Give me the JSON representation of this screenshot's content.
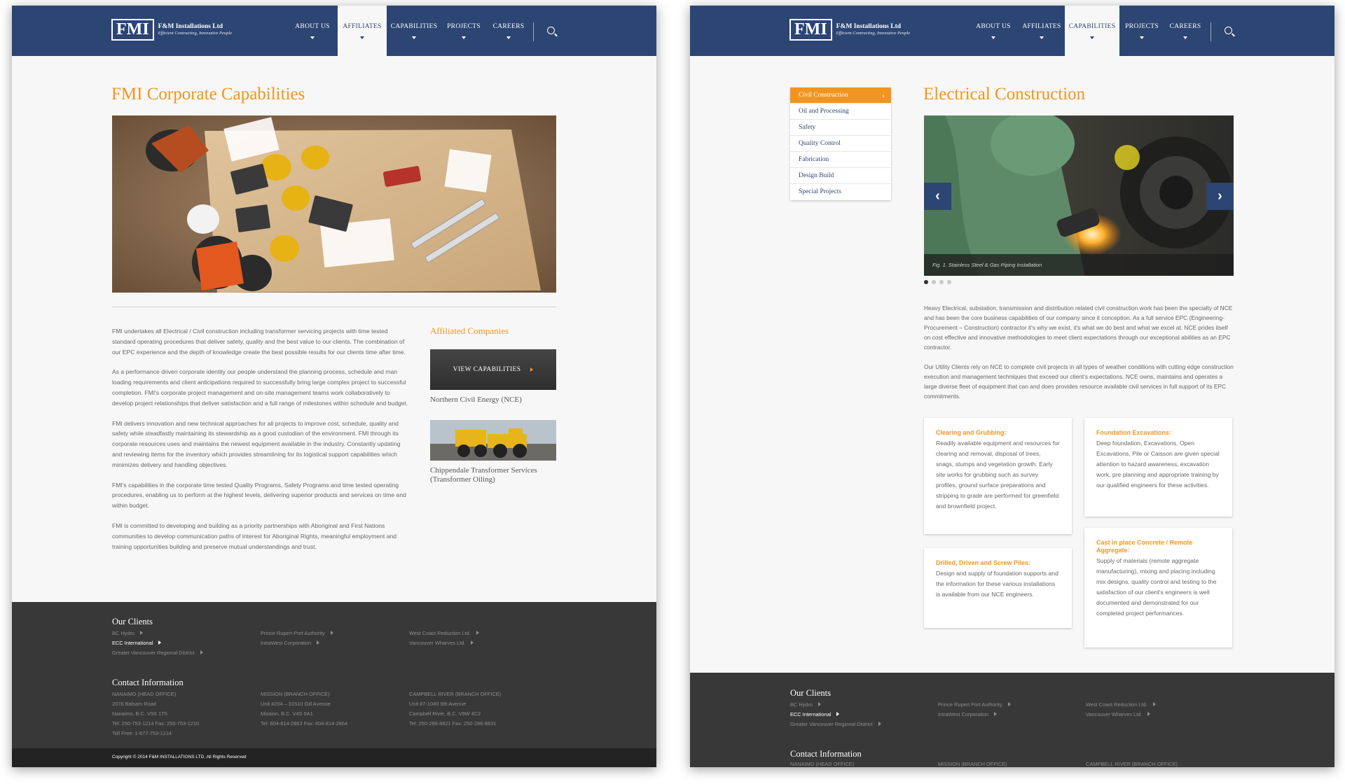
{
  "brand": {
    "logo_mark": "FMI",
    "company_name": "F&M Installations Ltd",
    "tagline": "Efficient Contracting, Innovative People"
  },
  "nav": {
    "items": [
      "ABOUT US",
      "AFFILIATES",
      "CAPABILITIES",
      "PROJECTS",
      "CAREERS"
    ]
  },
  "left_page": {
    "title": "FMI Corporate Capabilities",
    "paragraphs": [
      "FMI undertakes all Electrical / Civil construction including transformer servicing projects with time tested standard operating procedures that deliver safety, quality and the best value to our clients. The combination of our EPC experience and the depth of knowledge create the best possible results for our clients time after time.",
      "As a performance driven corporate identity our people understand the planning process, schedule and man loading requirements and client anticipations required to successfully bring large complex project to successful completion. FMI's corporate project management and on-site management teams work collaboratively to develop project relationships that deliver satisfaction and a full range of milestones within schedule and budget.",
      "FMI delivers innovation and new technical approaches for all projects to improve cost, schedule, quality and safety while steadfastly maintaining its stewardship as a good custodian of the environment.  FMI through its corporate resources uses and maintains the newest equipment available in the industry. Constantly updating and reviewing items for the inventory which provides streamlining for its logistical support capabilities which minimizes delivery and handling objectives.",
      "FMI's capabilities in the corporate time tested Quality Programs, Safety Programs and time tested operating procedures, enabling us to perform at the highest levels, delivering superior products and services on time and within budget.",
      "FMI is committed to developing and building as a priority partnerships with Aboriginal and First Nations communities to develop communication paths of interest for Aboriginal Rights, meaningful employment and training opportunities building and preserve mutual understandings and trust."
    ],
    "affiliated_heading": "Affiliated Companies",
    "affiliates": [
      {
        "button": "VIEW CAPABILITIES",
        "caption": "Northern Civil Energy (NCE)"
      },
      {
        "caption": "Chippendale Transformer Services (Transformer Oiling)"
      }
    ],
    "copyright": "Copyright © 2014 F&M INSTALLATIONS LTD. All Rights Reserved"
  },
  "right_page": {
    "submenu": [
      "Civil Construction",
      "Oil and Processing",
      "Safety",
      "Quality Control",
      "Fabrication",
      "Design Build",
      "Special Projects"
    ],
    "title": "Electrical Construction",
    "slider_caption": "Fig. 1. Stainless Steel & Gas Piping Installation",
    "paragraphs": [
      "Heavy Electrical, substation, transmission and distribution related civil construction work has been the specialty of NCE and has been the core business capabilities of our company since it conception. As a full service EPC (Engineering- Procurement – Construction) contractor it's why we exist, it's what we do best and what we excel at. NCE prides itself on cost effective and innovative methodologies to meet client expectations through our exceptional abilities as an EPC contractor.",
      "Our Utility Clients rely on NCE to complete civil projects in all types of weather conditions with cutting edge construction execution and management techniques that exceed our client's expectations. NCE owns, maintains and operates a large diverse fleet of equipment that can and does provides resource available civil services in full support of its EPC commitments."
    ],
    "cards": [
      {
        "title": "Clearing and Grubbing:",
        "text": "Readily available equipment and resources for clearing and removal, disposal of trees, snags, stumps and vegetation growth. Early site works for grubbing such as survey profiles, ground surface preparations and stripping to grade are performed for greenfield and brownfield project."
      },
      {
        "title": "Foundation Excavations:",
        "text": "Deep foundation, Excavations, Open Excavations, Pile or Caisson are given special attention to hazard awareness, excavation work, pre planning and appropriate training by our qualified engineers for these activities."
      },
      {
        "title": "Drilled, Driven and Screw Piles:",
        "text": "Design and supply of foundation supports and the information for these various installations is available from our NCE engineers."
      },
      {
        "title": "Cast in place Concrete / Remote Aggregate:",
        "text": "Supply of materials (remote aggregate manufacturing), mixing and placing including mix designs, quality control and testing to the satisfaction of our client's engineers is well documented and demonstrated for our completed project performances."
      }
    ]
  },
  "footer": {
    "clients_heading": "Our Clients",
    "clients": [
      [
        "BC Hydro",
        "ECC International",
        "Greater Vancouver Regional District"
      ],
      [
        "Prince Rupert Port Authority",
        "IntraWest Corporation"
      ],
      [
        "West Coast Reduction Ltd.",
        "Vancouver Wharves Ltd."
      ]
    ],
    "contact_heading": "Contact Information",
    "offices": [
      [
        "NANAIMO (HEAD OFFICE)",
        "2076 Balsam Road",
        "Nanaimo, B.C. V9X 1T5",
        "Tel: 250-753-1214 Fax: 250-753-1210",
        "Toll Free: 1-877-753-1214"
      ],
      [
        "MISSION (BRANCH OFFICE)",
        "Unit #204 – 31510 Gill Avenue",
        "Mission, B.C. V4S 0A1",
        "Tel: 604-814-2863 Fax: 604-814-2864"
      ],
      [
        "CAMPBELL RIVER (BRANCH OFFICE)",
        "Unit #7-1040 9th Avenue",
        "Campbell River, B.C. V9W 4C2",
        "Tel: 250-286-8821 Fax: 250-286-8831"
      ]
    ]
  }
}
